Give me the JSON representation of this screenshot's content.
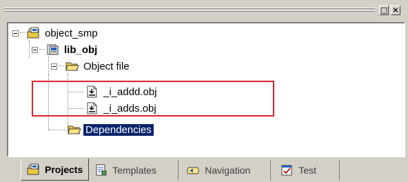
{
  "panel": {
    "buttons": {
      "restore": "□",
      "close": "×"
    }
  },
  "tree": {
    "root": {
      "label": "object_smp",
      "icon": "workspace-icon"
    },
    "project": {
      "label": "lib_obj",
      "icon": "project-icon"
    },
    "folder": {
      "label": "Object file",
      "icon": "open-folder-icon"
    },
    "files": [
      {
        "label": "_i_addd.obj",
        "icon": "object-file-icon"
      },
      {
        "label": "_i_adds.obj",
        "icon": "object-file-icon"
      }
    ],
    "dependencies": {
      "label": "Dependencies",
      "icon": "folder-icon"
    }
  },
  "tabs": [
    {
      "label": "Projects",
      "icon": "projects-icon",
      "active": true
    },
    {
      "label": "Templates",
      "icon": "templates-icon",
      "active": false
    },
    {
      "label": "Navigation",
      "icon": "navigation-icon",
      "active": false
    },
    {
      "label": "Test",
      "icon": "test-icon",
      "active": false
    }
  ],
  "colors": {
    "selection": "#0a246a",
    "highlight_box": "#e0202a",
    "panel_bg": "#d4d0c8"
  }
}
